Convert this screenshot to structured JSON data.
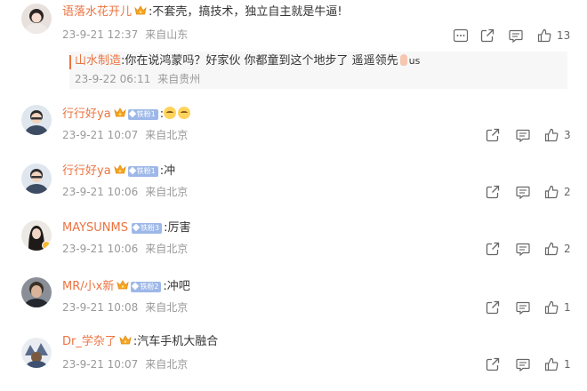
{
  "comments": [
    {
      "name": "语落水花开儿",
      "text": ":不套壳，搞技术，独立自主就是牛逼!",
      "time": "23-9-21 12:37",
      "source": "来自山东",
      "likes": "13",
      "reply": {
        "name": "山水制造",
        "text": ":你在说鸿蒙吗？好家伙  你都童到这个地步了  遥遥领先",
        "suffix": "us",
        "time": "23-9-22 06:11",
        "source": "来自贵州"
      }
    },
    {
      "name": "行行好ya",
      "badge": "铁粉1",
      "text": ":",
      "time": "23-9-21 10:07",
      "source": "来自北京",
      "likes": "3"
    },
    {
      "name": "行行好ya",
      "badge": "铁粉1",
      "text": ":冲",
      "time": "23-9-21 10:06",
      "source": "来自北京",
      "likes": "2"
    },
    {
      "name": "MAYSUNMS",
      "badge": "铁粉3",
      "text": ":厉害",
      "time": "23-9-21 10:06",
      "source": "来自北京",
      "likes": "2"
    },
    {
      "name": "MR/小x新",
      "badge": "铁粉2",
      "text": ":冲吧",
      "time": "23-9-21 10:08",
      "source": "来自北京",
      "likes": "1"
    },
    {
      "name": "Dr_学杂了",
      "text": ":汽车手机大融合",
      "time": "23-9-21 10:07",
      "source": "来自北京",
      "likes": "1"
    }
  ],
  "colors": {
    "username": "#eb7340",
    "meta": "#999999",
    "badge": "#9db8e8"
  },
  "icons": [
    "more-icon",
    "share-icon",
    "comment-icon",
    "like-icon",
    "crown-icon"
  ]
}
